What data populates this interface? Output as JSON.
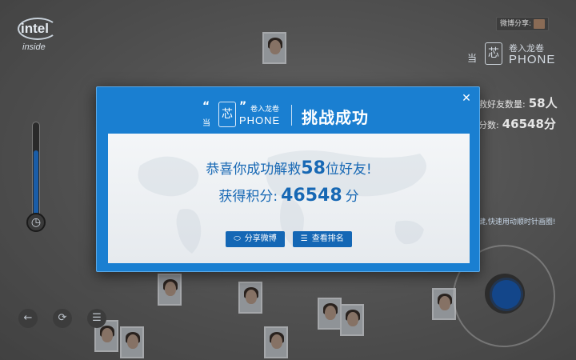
{
  "brand": {
    "logo_word": "intel",
    "logo_sub": "inside"
  },
  "campaign": {
    "quote_open": "“",
    "quote_close": "”",
    "dang": "当",
    "chip": "芯",
    "line1": "卷入龙卷",
    "line2": "PHONE"
  },
  "share_tag": "微博分享:",
  "stats": {
    "rescued_label": "救好友数量:",
    "rescued_value": "58人",
    "score_label": "分数:",
    "score_value": "46548分"
  },
  "hint": "键,快速用动顺时针画圈!",
  "thermometer": {
    "level_percent": 80
  },
  "bottom_icons": [
    "back-arrow-icon",
    "refresh-icon",
    "list-icon"
  ],
  "modal": {
    "close": "✕",
    "title": "挑战成功",
    "message_prefix": "恭喜你成功解救",
    "rescued": "58",
    "message_suffix": "位好友!",
    "score_prefix": "获得积分:",
    "score": "46548",
    "score_suffix": "分",
    "share_button": "分享微博",
    "rank_button": "查看排名"
  },
  "colors": {
    "modal_blue": "#1a7fd1",
    "text_blue": "#1768b4",
    "button_blue": "#1467b5"
  }
}
